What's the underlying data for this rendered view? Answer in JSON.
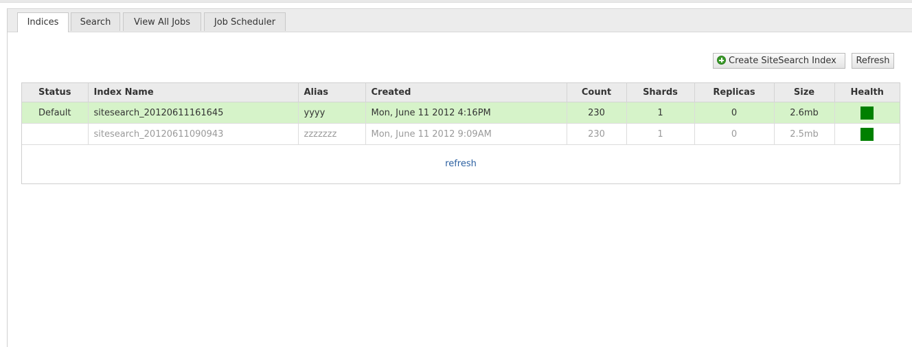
{
  "tabs": [
    {
      "label": "Indices",
      "active": true
    },
    {
      "label": "Search",
      "active": false
    },
    {
      "label": "View All Jobs",
      "active": false
    },
    {
      "label": "Job Scheduler",
      "active": false
    }
  ],
  "toolbar": {
    "create_label": "Create SiteSearch Index",
    "create_icon": "plus-circle-icon",
    "refresh_label": "Refresh"
  },
  "table": {
    "columns": [
      "Status",
      "Index Name",
      "Alias",
      "Created",
      "Count",
      "Shards",
      "Replicas",
      "Size",
      "Health"
    ],
    "rows": [
      {
        "status": "Default",
        "index_name": "sitesearch_20120611161645",
        "alias": "yyyy",
        "created": "Mon, June 11 2012 4:16PM",
        "count": "230",
        "shards": "1",
        "replicas": "0",
        "size": "2.6mb",
        "health_color": "#008000"
      },
      {
        "status": "",
        "index_name": "sitesearch_20120611090943",
        "alias": "zzzzzzz",
        "created": "Mon, June 11 2012 9:09AM",
        "count": "230",
        "shards": "1",
        "replicas": "0",
        "size": "2.5mb",
        "health_color": "#008000"
      }
    ]
  },
  "footer": {
    "refresh_link": "refresh"
  },
  "colors": {
    "default_row_bg": "#d6f3c9",
    "link": "#2a5fa0",
    "health_green": "#008000"
  }
}
